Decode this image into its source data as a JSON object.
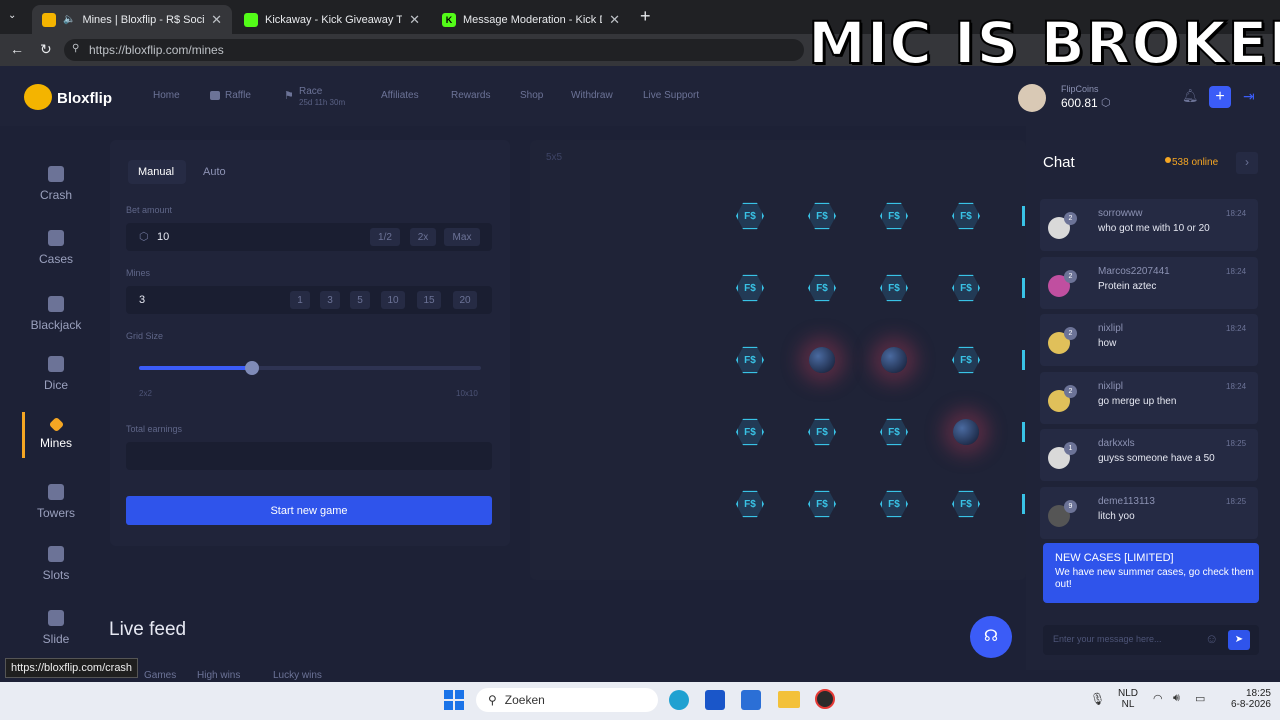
{
  "browser": {
    "tabs": [
      {
        "title": "Mines | Bloxflip - R$ Social Ca",
        "active": true,
        "icon_color": "#f4b400"
      },
      {
        "title": "Kickaway - Kick Giveaway Tool",
        "active": false,
        "icon_color": "#53fc18"
      },
      {
        "title": "Message Moderation - Kick Dashb",
        "active": false,
        "icon_color": "#53fc18"
      }
    ],
    "new_tab": "+",
    "url": "https://bloxflip.com/mines",
    "status_url": "https://bloxflip.com/crash"
  },
  "overlay_text": "MIC IS BROKEN",
  "site": {
    "logo": "Bloxflip",
    "nav": {
      "home": "Home",
      "raffle": "Raffle",
      "race": "Race",
      "race_timer": "25d 11h 30m",
      "affiliates": "Affiliates",
      "rewards": "Rewards",
      "shop": "Shop",
      "withdraw": "Withdraw",
      "support": "Live Support"
    },
    "wallet": {
      "label": "FlipCoins",
      "amount": "600.81"
    }
  },
  "sidebar": {
    "items": [
      {
        "label": "Crash",
        "icon": "rocket-icon"
      },
      {
        "label": "Cases",
        "icon": "cases-icon"
      },
      {
        "label": "Blackjack",
        "icon": "cards-icon"
      },
      {
        "label": "Dice",
        "icon": "dice-icon"
      },
      {
        "label": "Mines",
        "icon": "gem-icon",
        "active": true
      },
      {
        "label": "Towers",
        "icon": "tower-icon"
      },
      {
        "label": "Slots",
        "icon": "slots-icon"
      },
      {
        "label": "Slide",
        "icon": "slide-icon"
      }
    ]
  },
  "controls": {
    "tab_manual": "Manual",
    "tab_auto": "Auto",
    "bet_label": "Bet amount",
    "bet_value": "10",
    "bet_buttons": [
      "1/2",
      "2x",
      "Max"
    ],
    "mines_label": "Mines",
    "mines_value": "3",
    "mines_options": [
      "1",
      "3",
      "5",
      "10",
      "15",
      "20"
    ],
    "grid_label": "Grid Size",
    "grid_min": "2x2",
    "grid_max": "10x10",
    "grid_level_fraction": 0.33,
    "earnings_label": "Total earnings",
    "start_button": "Start new game"
  },
  "board": {
    "size_label": "5x5",
    "tile_text": "F$",
    "rows": [
      [
        "gem",
        "gem",
        "gem",
        "gem"
      ],
      [
        "gem",
        "gem",
        "gem",
        "gem"
      ],
      [
        "gem",
        "bomb",
        "bomb",
        "gem"
      ],
      [
        "gem",
        "gem",
        "gem",
        "bomb"
      ],
      [
        "gem",
        "gem",
        "gem",
        "gem"
      ]
    ]
  },
  "live_feed": {
    "title": "Live feed",
    "tabs": [
      "Games",
      "High wins",
      "Lucky wins"
    ]
  },
  "chat": {
    "title": "Chat",
    "online": "538 online",
    "messages": [
      {
        "user": "sorrowww",
        "text": "who got me with 10 or 20",
        "time": "18:24",
        "level": "2"
      },
      {
        "user": "Marcos2207441",
        "text": "Protein aztec",
        "time": "18:24",
        "level": "2"
      },
      {
        "user": "nixlipl",
        "text": "how",
        "time": "18:24",
        "level": "2"
      },
      {
        "user": "nixlipl",
        "text": "go merge up then",
        "time": "18:24",
        "level": "2"
      },
      {
        "user": "darkxxls",
        "text": "guyss someone have a 50",
        "time": "18:25",
        "level": "1"
      },
      {
        "user": "deme113113",
        "text": "litch yoo",
        "time": "18:25",
        "level": "9"
      }
    ],
    "promo_title": "NEW CASES [LIMITED]",
    "promo_text": "We have new summer cases, go check them out!",
    "input_placeholder": "Enter your message here..."
  },
  "taskbar": {
    "search": "Zoeken",
    "lang": "NLD",
    "lang2": "NL",
    "time": "18:25",
    "date": "6-8-2026"
  }
}
